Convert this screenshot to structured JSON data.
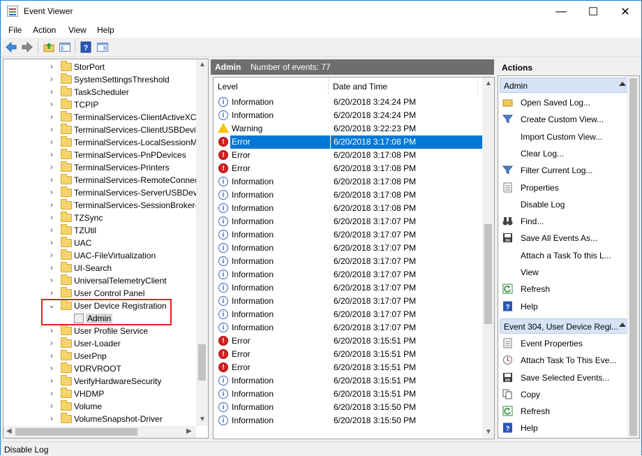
{
  "window": {
    "title": "Event Viewer",
    "minimize_glyph": "—",
    "maximize_glyph": "☐",
    "close_glyph": "✕"
  },
  "menu": [
    "File",
    "Action",
    "View",
    "Help"
  ],
  "toolbar": {
    "icons": [
      "back-icon",
      "forward-icon",
      "up-folder-icon",
      "show-hide-tree-icon",
      "help-icon",
      "show-hide-action-pane-icon"
    ]
  },
  "tree": {
    "items": [
      {
        "label": "StorPort",
        "chevron": "›"
      },
      {
        "label": "SystemSettingsThreshold",
        "chevron": "›"
      },
      {
        "label": "TaskScheduler",
        "chevron": "›"
      },
      {
        "label": "TCPIP",
        "chevron": "›"
      },
      {
        "label": "TerminalServices-ClientActiveXCore",
        "chevron": "›"
      },
      {
        "label": "TerminalServices-ClientUSBDevices",
        "chevron": "›"
      },
      {
        "label": "TerminalServices-LocalSessionManager",
        "chevron": "›"
      },
      {
        "label": "TerminalServices-PnPDevices",
        "chevron": "›"
      },
      {
        "label": "TerminalServices-Printers",
        "chevron": "›"
      },
      {
        "label": "TerminalServices-RemoteConnectionManager",
        "chevron": "›"
      },
      {
        "label": "TerminalServices-ServerUSBDevices",
        "chevron": "›"
      },
      {
        "label": "TerminalServices-SessionBroker-Client",
        "chevron": "›"
      },
      {
        "label": "TZSync",
        "chevron": "›"
      },
      {
        "label": "TZUtil",
        "chevron": "›"
      },
      {
        "label": "UAC",
        "chevron": "›"
      },
      {
        "label": "UAC-FileVirtualization",
        "chevron": "›"
      },
      {
        "label": "UI-Search",
        "chevron": "›"
      },
      {
        "label": "UniversalTelemetryClient",
        "chevron": "›"
      },
      {
        "label": "User Control Panel",
        "chevron": "›"
      },
      {
        "label": "User Device Registration",
        "chevron": "⌄"
      },
      {
        "label": "Admin",
        "chevron": "",
        "type": "log"
      },
      {
        "label": "User Profile Service",
        "chevron": "›"
      },
      {
        "label": "User-Loader",
        "chevron": "›"
      },
      {
        "label": "UserPnp",
        "chevron": "›"
      },
      {
        "label": "VDRVROOT",
        "chevron": "›"
      },
      {
        "label": "VerifyHardwareSecurity",
        "chevron": "›"
      },
      {
        "label": "VHDMP",
        "chevron": "›"
      },
      {
        "label": "Volume",
        "chevron": "›"
      },
      {
        "label": "VolumeSnapshot-Driver",
        "chevron": "›"
      }
    ]
  },
  "center": {
    "log_name": "Admin",
    "count_text": "Number of events: 77",
    "columns": [
      "Level",
      "Date and Time"
    ],
    "events": [
      {
        "level": "Information",
        "date": "6/20/2018 3:24:24 PM"
      },
      {
        "level": "Information",
        "date": "6/20/2018 3:24:24 PM"
      },
      {
        "level": "Warning",
        "date": "6/20/2018 3:22:23 PM"
      },
      {
        "level": "Error",
        "date": "6/20/2018 3:17:08 PM",
        "selected": true
      },
      {
        "level": "Error",
        "date": "6/20/2018 3:17:08 PM"
      },
      {
        "level": "Error",
        "date": "6/20/2018 3:17:08 PM"
      },
      {
        "level": "Information",
        "date": "6/20/2018 3:17:08 PM"
      },
      {
        "level": "Information",
        "date": "6/20/2018 3:17:08 PM"
      },
      {
        "level": "Information",
        "date": "6/20/2018 3:17:08 PM"
      },
      {
        "level": "Information",
        "date": "6/20/2018 3:17:07 PM"
      },
      {
        "level": "Information",
        "date": "6/20/2018 3:17:07 PM"
      },
      {
        "level": "Information",
        "date": "6/20/2018 3:17:07 PM"
      },
      {
        "level": "Information",
        "date": "6/20/2018 3:17:07 PM"
      },
      {
        "level": "Information",
        "date": "6/20/2018 3:17:07 PM"
      },
      {
        "level": "Information",
        "date": "6/20/2018 3:17:07 PM"
      },
      {
        "level": "Information",
        "date": "6/20/2018 3:17:07 PM"
      },
      {
        "level": "Information",
        "date": "6/20/2018 3:17:07 PM"
      },
      {
        "level": "Information",
        "date": "6/20/2018 3:17:07 PM"
      },
      {
        "level": "Error",
        "date": "6/20/2018 3:15:51 PM"
      },
      {
        "level": "Error",
        "date": "6/20/2018 3:15:51 PM"
      },
      {
        "level": "Error",
        "date": "6/20/2018 3:15:51 PM"
      },
      {
        "level": "Information",
        "date": "6/20/2018 3:15:51 PM"
      },
      {
        "level": "Information",
        "date": "6/20/2018 3:15:51 PM"
      },
      {
        "level": "Information",
        "date": "6/20/2018 3:15:50 PM"
      },
      {
        "level": "Information",
        "date": "6/20/2018 3:15:50 PM"
      }
    ]
  },
  "actions": {
    "title": "Actions",
    "sections": [
      {
        "header": "Admin",
        "items": [
          {
            "label": "Open Saved Log...",
            "icon": "open-folder-icon",
            "submenu": false
          },
          {
            "label": "Create Custom View...",
            "icon": "filter-icon",
            "submenu": false
          },
          {
            "label": "Import Custom View...",
            "icon": "",
            "submenu": false
          },
          {
            "label": "Clear Log...",
            "icon": "",
            "submenu": false
          },
          {
            "label": "Filter Current Log...",
            "icon": "filter-icon",
            "submenu": false
          },
          {
            "label": "Properties",
            "icon": "properties-icon",
            "submenu": false
          },
          {
            "label": "Disable Log",
            "icon": "",
            "submenu": false
          },
          {
            "label": "Find...",
            "icon": "binoculars-icon",
            "submenu": false
          },
          {
            "label": "Save All Events As...",
            "icon": "save-icon",
            "submenu": false
          },
          {
            "label": "Attach a Task To this L...",
            "icon": "",
            "submenu": false
          },
          {
            "label": "View",
            "icon": "",
            "submenu": true
          },
          {
            "label": "Refresh",
            "icon": "refresh-icon",
            "submenu": false
          },
          {
            "label": "Help",
            "icon": "help-icon",
            "submenu": true
          }
        ]
      },
      {
        "header": "Event 304, User Device Regi...",
        "items": [
          {
            "label": "Event Properties",
            "icon": "properties-icon",
            "submenu": false
          },
          {
            "label": "Attach Task To This Eve...",
            "icon": "task-icon",
            "submenu": false
          },
          {
            "label": "Save Selected Events...",
            "icon": "save-icon",
            "submenu": false
          },
          {
            "label": "Copy",
            "icon": "copy-icon",
            "submenu": true
          },
          {
            "label": "Refresh",
            "icon": "refresh-icon",
            "submenu": false
          },
          {
            "label": "Help",
            "icon": "help-icon",
            "submenu": true
          }
        ]
      }
    ]
  },
  "status": {
    "text": "Disable Log"
  },
  "colors": {
    "selection": "#0078d7",
    "section_header": "#d6e4f6",
    "annotation_box": "#e02020",
    "header_bar": "#6e6e6e"
  }
}
